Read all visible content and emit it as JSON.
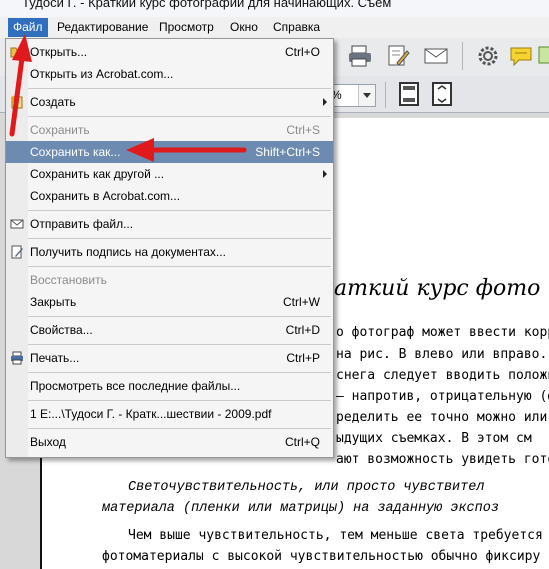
{
  "window": {
    "title": "Тудоси Г. - Краткий курс фотографии для начинающих. Съем"
  },
  "menubar": {
    "items": [
      "Файл",
      "Редактирование",
      "Просмотр",
      "Окно",
      "Справка"
    ],
    "active": "Файл"
  },
  "toolbar": {
    "zoom_value": "%"
  },
  "file_menu": {
    "items": [
      {
        "label": "Открыть...",
        "shortcut": "Ctrl+O",
        "state": "normal",
        "icon": "open-folder-icon"
      },
      {
        "label": "Открыть из Acrobat.com...",
        "shortcut": "",
        "state": "normal"
      },
      {
        "label": "Создать",
        "shortcut": "",
        "state": "normal",
        "submenu": true,
        "icon": "create-icon"
      },
      {
        "label": "Сохранить",
        "shortcut": "Ctrl+S",
        "state": "disabled"
      },
      {
        "label": "Сохранить как...",
        "shortcut": "Shift+Ctrl+S",
        "state": "highlighted"
      },
      {
        "label": "Сохранить как другой ...",
        "shortcut": "",
        "state": "normal",
        "submenu": true
      },
      {
        "label": "Сохранить в Acrobat.com...",
        "shortcut": "",
        "state": "normal"
      },
      {
        "label": "Отправить файл...",
        "shortcut": "",
        "state": "normal",
        "icon": "mail-icon"
      },
      {
        "label": "Получить подпись на документах...",
        "shortcut": "",
        "state": "normal",
        "icon": "sign-icon"
      },
      {
        "label": "Восстановить",
        "shortcut": "",
        "state": "disabled"
      },
      {
        "label": "Закрыть",
        "shortcut": "Ctrl+W",
        "state": "normal"
      },
      {
        "label": "Свойства...",
        "shortcut": "Ctrl+D",
        "state": "normal"
      },
      {
        "label": "Печать...",
        "shortcut": "Ctrl+P",
        "state": "normal",
        "icon": "printer-icon"
      },
      {
        "label": "Просмотреть все последние файлы...",
        "shortcut": "",
        "state": "normal"
      },
      {
        "label": "1 E:...\\Тудоси Г. - Кратк...шествии - 2009.pdf",
        "shortcut": "",
        "state": "normal"
      },
      {
        "label": "Выход",
        "shortcut": "Ctrl+Q",
        "state": "normal"
      }
    ]
  },
  "document": {
    "heading": "аткий курс фото",
    "lines": [
      "о фотограф может ввести корр",
      "на рис. В влево или вправо.",
      "снега следует вводить положи",
      "— напротив, отрицательную (ф",
      "ределить ее точно можно или",
      "ыдущих съемках. В этом см",
      "ают возможность увидеть готов"
    ],
    "italic_lines": [
      "Светочувствительность, или просто чувствител",
      "материала (пленки или матрицы) на заданную экспоз"
    ],
    "body_lines": [
      "Чем выше чувствительность, тем меньше света требуется д",
      "фотоматериалы с высокой чувствительностью обычно фиксиру"
    ]
  },
  "colors": {
    "menu_highlight": "#6d8bb0",
    "menubar_active": "#2f6fbd",
    "arrow_red": "#e0191c"
  }
}
